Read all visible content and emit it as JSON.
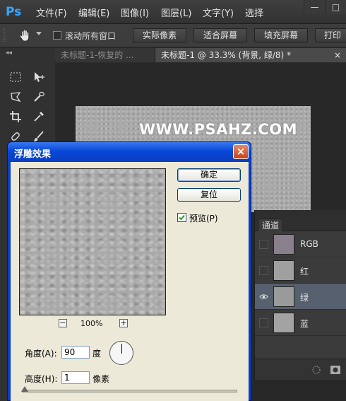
{
  "app": {
    "logo": "Ps"
  },
  "menu": [
    "文件(F)",
    "编辑(E)",
    "图像(I)",
    "图层(L)",
    "文字(Y)",
    "选择"
  ],
  "window_buttons": [
    "—",
    "□"
  ],
  "options_bar": {
    "scroll_all_windows": "滚动所有窗口",
    "buttons": [
      "实际像素",
      "适合屏幕",
      "填充屏幕",
      "打印"
    ]
  },
  "tabs": [
    {
      "label": "未标题-1-恢复的 ...",
      "active": false
    },
    {
      "label": "未标题-1 @ 33.3% (背景, 绿/8) *",
      "close": "×",
      "active": true
    }
  ],
  "canvas": {
    "watermark": "WWW.PSAHZ.COM"
  },
  "channels_panel": {
    "tab": "通道",
    "channels": [
      {
        "name": "RGB",
        "visible": false,
        "selected": false,
        "thumb_color": "#8a7f8c"
      },
      {
        "name": "红",
        "visible": false,
        "selected": false,
        "thumb_color": "#a0a0a0"
      },
      {
        "name": "绿",
        "visible": true,
        "selected": true,
        "thumb_color": "#9a9a9a"
      },
      {
        "name": "蓝",
        "visible": false,
        "selected": false,
        "thumb_color": "#a3a3a3"
      }
    ]
  },
  "dialog": {
    "title": "浮雕效果",
    "close": "×",
    "ok": "确定",
    "reset": "复位",
    "preview_checked": true,
    "preview_label": "预览(P)",
    "zoom": "100%",
    "zoom_out": "−",
    "zoom_in": "+",
    "angle_label": "角度(A):",
    "angle_value": "90",
    "angle_unit": "度",
    "height_label": "高度(H):",
    "height_value": "1",
    "height_unit": "像素"
  },
  "colors": {
    "dialog_title": "#0848d8",
    "dialog_body": "#ece9d8",
    "selected_channel": "#57606e",
    "ps_blue": "#31a8ff"
  }
}
